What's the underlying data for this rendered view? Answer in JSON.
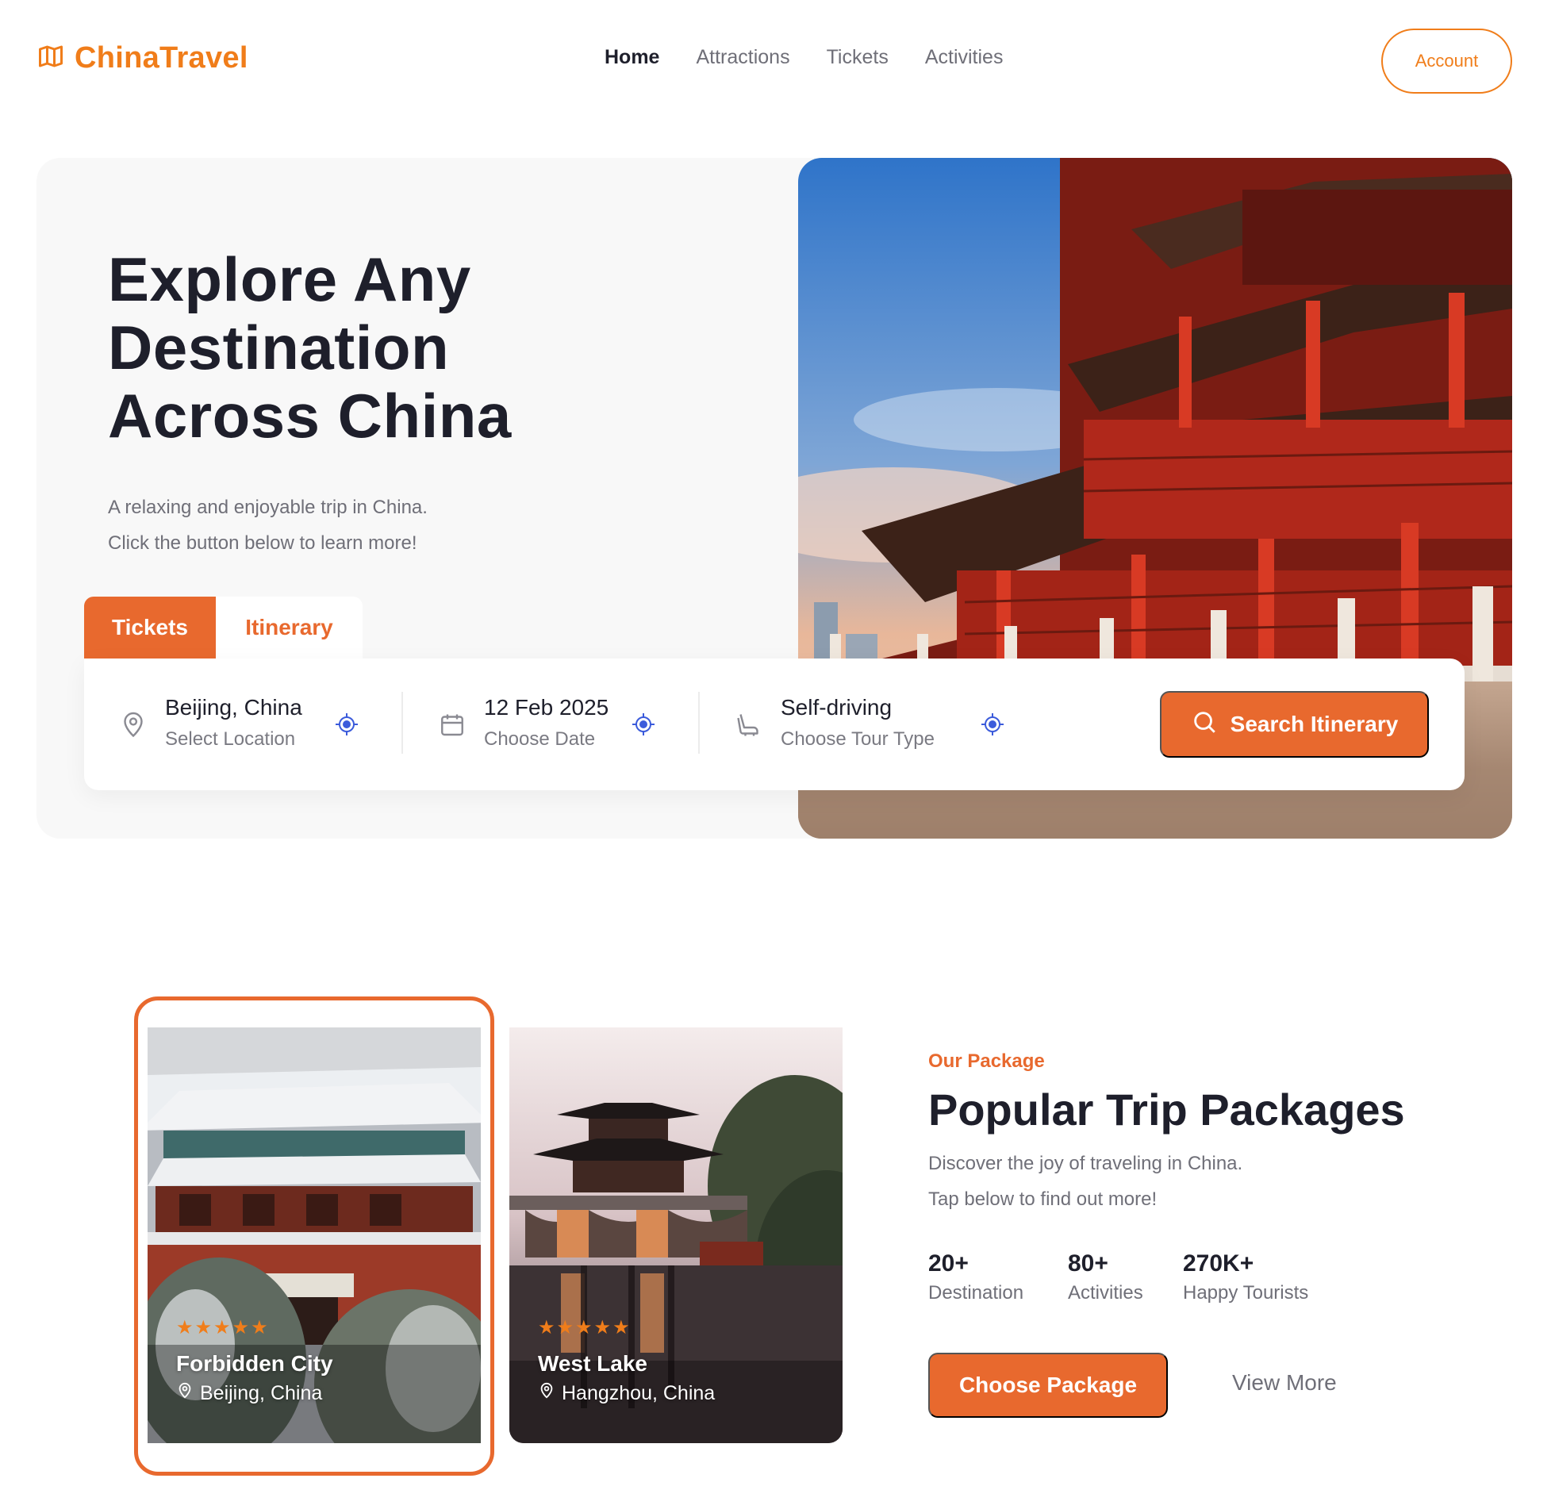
{
  "brand": {
    "name": "ChinaTravel",
    "icon": "map-icon",
    "color": "#f07d1a"
  },
  "nav": {
    "links": [
      "Home",
      "Attractions",
      "Tickets",
      "Activities"
    ],
    "active": "Home",
    "account_label": "Account"
  },
  "hero": {
    "title": "Explore Any\nDestination\nAcross China",
    "subtitle_line1": "A relaxing and enjoyable trip in China.",
    "subtitle_line2": "Click the button below to learn more!",
    "tabs": [
      "Tickets",
      "Itinerary"
    ],
    "active_tab": "Tickets"
  },
  "search": {
    "fields": [
      {
        "value": "Beijing, China",
        "label": "Select Location",
        "icon": "location-pin-icon"
      },
      {
        "value": "12 Feb 2025",
        "label": "Choose Date",
        "icon": "calendar-icon"
      },
      {
        "value": "Self-driving",
        "label": "Choose Tour Type",
        "icon": "seat-icon"
      }
    ],
    "button_label": "Search Itinerary",
    "button_icon": "search-icon"
  },
  "packages": {
    "cards": [
      {
        "name": "Forbidden City",
        "location": "Beijing, China",
        "rating": 5,
        "stars": "★★★★★",
        "selected": true
      },
      {
        "name": "West Lake",
        "location": "Hangzhou, China",
        "rating": 5,
        "stars": "★★★★★",
        "selected": false
      }
    ],
    "eyebrow": "Our Package",
    "title": "Popular Trip Packages",
    "subtitle_line1": "Discover the joy of traveling in China.",
    "subtitle_line2": "Tap below to find out more!",
    "stats": [
      {
        "value": "20+",
        "label": "Destination"
      },
      {
        "value": "80+",
        "label": "Activities"
      },
      {
        "value": "270K+",
        "label": "Happy Tourists"
      }
    ],
    "choose_label": "Choose Package",
    "view_more_label": "View More"
  },
  "colors": {
    "accent": "#e8692e",
    "brand": "#f07d1a",
    "target_blue": "#3b5bdb",
    "text_dark": "#1e1f2b",
    "text_muted": "#6f6f78"
  }
}
